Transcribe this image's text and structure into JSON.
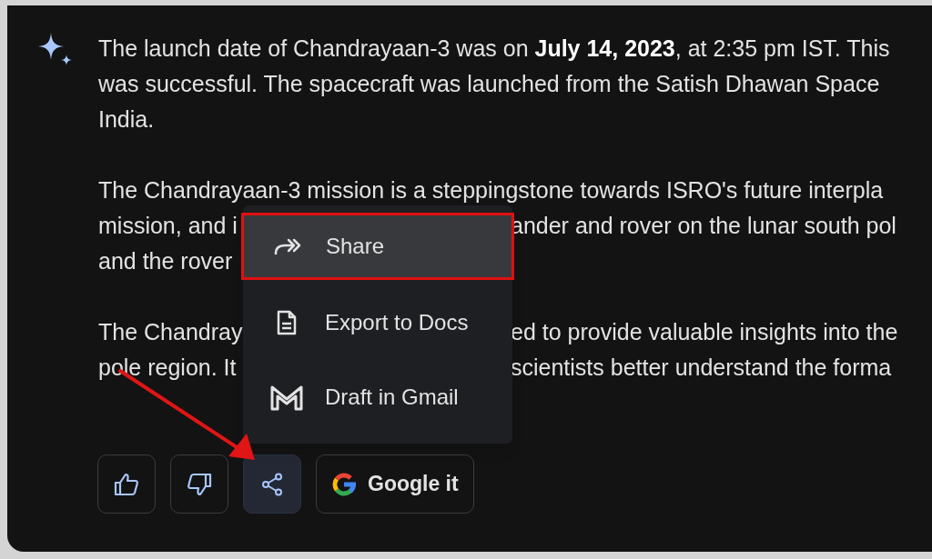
{
  "response": {
    "paragraphs": [
      {
        "lines": [
          {
            "segments": [
              "The launch date of Chandrayaan-3 was on **July 14, 2023**, at 2:35 pm IST. This"
            ]
          },
          {
            "segments": [
              "was successful. The spacecraft was launched from the Satish Dhawan Space"
            ]
          },
          {
            "segments": [
              "India."
            ]
          }
        ]
      },
      {
        "lines": [
          {
            "segments": [
              "The Chandrayaan-3 mission is a steppingstone towards ISRO's future interpla"
            ]
          },
          {
            "segments": [
              "mission, and i",
              "ander and rover on the lunar south pol"
            ]
          },
          {
            "segments": [
              "and the rover"
            ]
          }
        ]
      },
      {
        "lines": [
          {
            "segments": [
              "The Chandray",
              "ed to provide valuable insights into the"
            ]
          },
          {
            "segments": [
              "pole region. It",
              "scientists better understand the forma"
            ]
          }
        ]
      }
    ]
  },
  "menu": {
    "items": [
      {
        "kind": "share",
        "label": "Share",
        "selected": true
      },
      {
        "kind": "docs",
        "label": "Export to Docs",
        "selected": false
      },
      {
        "kind": "gmail",
        "label": "Draft in Gmail",
        "selected": false
      }
    ]
  },
  "actions": [
    {
      "kind": "thumbs-up",
      "selected": false
    },
    {
      "kind": "thumbs-down",
      "selected": false
    },
    {
      "kind": "share",
      "selected": true
    },
    {
      "kind": "google",
      "label": "Google it",
      "selected": false
    }
  ]
}
